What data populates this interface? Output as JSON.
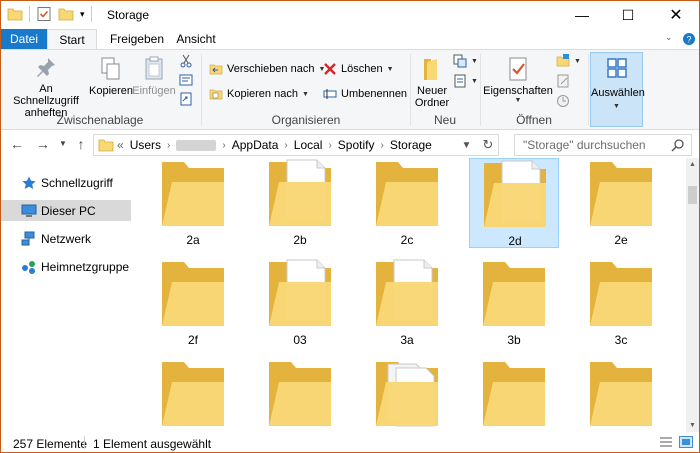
{
  "window": {
    "title": "Storage"
  },
  "tabs": {
    "file": "Datei",
    "start": "Start",
    "share": "Freigeben",
    "view": "Ansicht"
  },
  "ribbon": {
    "clipboard": {
      "label": "Zwischenablage",
      "pin_line1": "An Schnellzugriff",
      "pin_line2": "anheften",
      "copy": "Kopieren",
      "paste": "Einfügen"
    },
    "organize": {
      "label": "Organisieren",
      "move_to": "Verschieben nach",
      "copy_to": "Kopieren nach",
      "delete": "Löschen",
      "rename": "Umbenennen"
    },
    "new": {
      "label": "Neu",
      "new_folder_line1": "Neuer",
      "new_folder_line2": "Ordner"
    },
    "open": {
      "label": "Öffnen",
      "properties": "Eigenschaften"
    },
    "select": {
      "select_all": "Auswählen"
    }
  },
  "address": {
    "overflow": "«",
    "crumbs": [
      "Users",
      "AppData",
      "Local",
      "Spotify",
      "Storage"
    ]
  },
  "search": {
    "placeholder": "\"Storage\" durchsuchen"
  },
  "sidebar": {
    "items": [
      {
        "label": "Schnellzugriff",
        "icon": "star-icon"
      },
      {
        "label": "Dieser PC",
        "icon": "computer-icon",
        "selected": true
      },
      {
        "label": "Netzwerk",
        "icon": "network-icon"
      },
      {
        "label": "Heimnetzgruppe",
        "icon": "homegroup-icon"
      }
    ]
  },
  "items": [
    {
      "name": "2a",
      "type": "folder"
    },
    {
      "name": "2b",
      "type": "folder-doc"
    },
    {
      "name": "2c",
      "type": "folder"
    },
    {
      "name": "2d",
      "type": "folder-doc",
      "selected": true
    },
    {
      "name": "2e",
      "type": "folder"
    },
    {
      "name": "2f",
      "type": "folder"
    },
    {
      "name": "03",
      "type": "folder-doc"
    },
    {
      "name": "3a",
      "type": "folder-doc"
    },
    {
      "name": "3b",
      "type": "folder"
    },
    {
      "name": "3c",
      "type": "folder"
    },
    {
      "name": "",
      "type": "folder"
    },
    {
      "name": "",
      "type": "folder"
    },
    {
      "name": "",
      "type": "folder-docs"
    },
    {
      "name": "",
      "type": "folder"
    },
    {
      "name": "",
      "type": "folder"
    }
  ],
  "status": {
    "count": "257 Elemente",
    "selection": "1 Element ausgewählt"
  },
  "colors": {
    "accent": "#1979ca",
    "folder": "#f8d775",
    "folder_dark": "#e3b33d",
    "selection": "#cce8ff"
  }
}
